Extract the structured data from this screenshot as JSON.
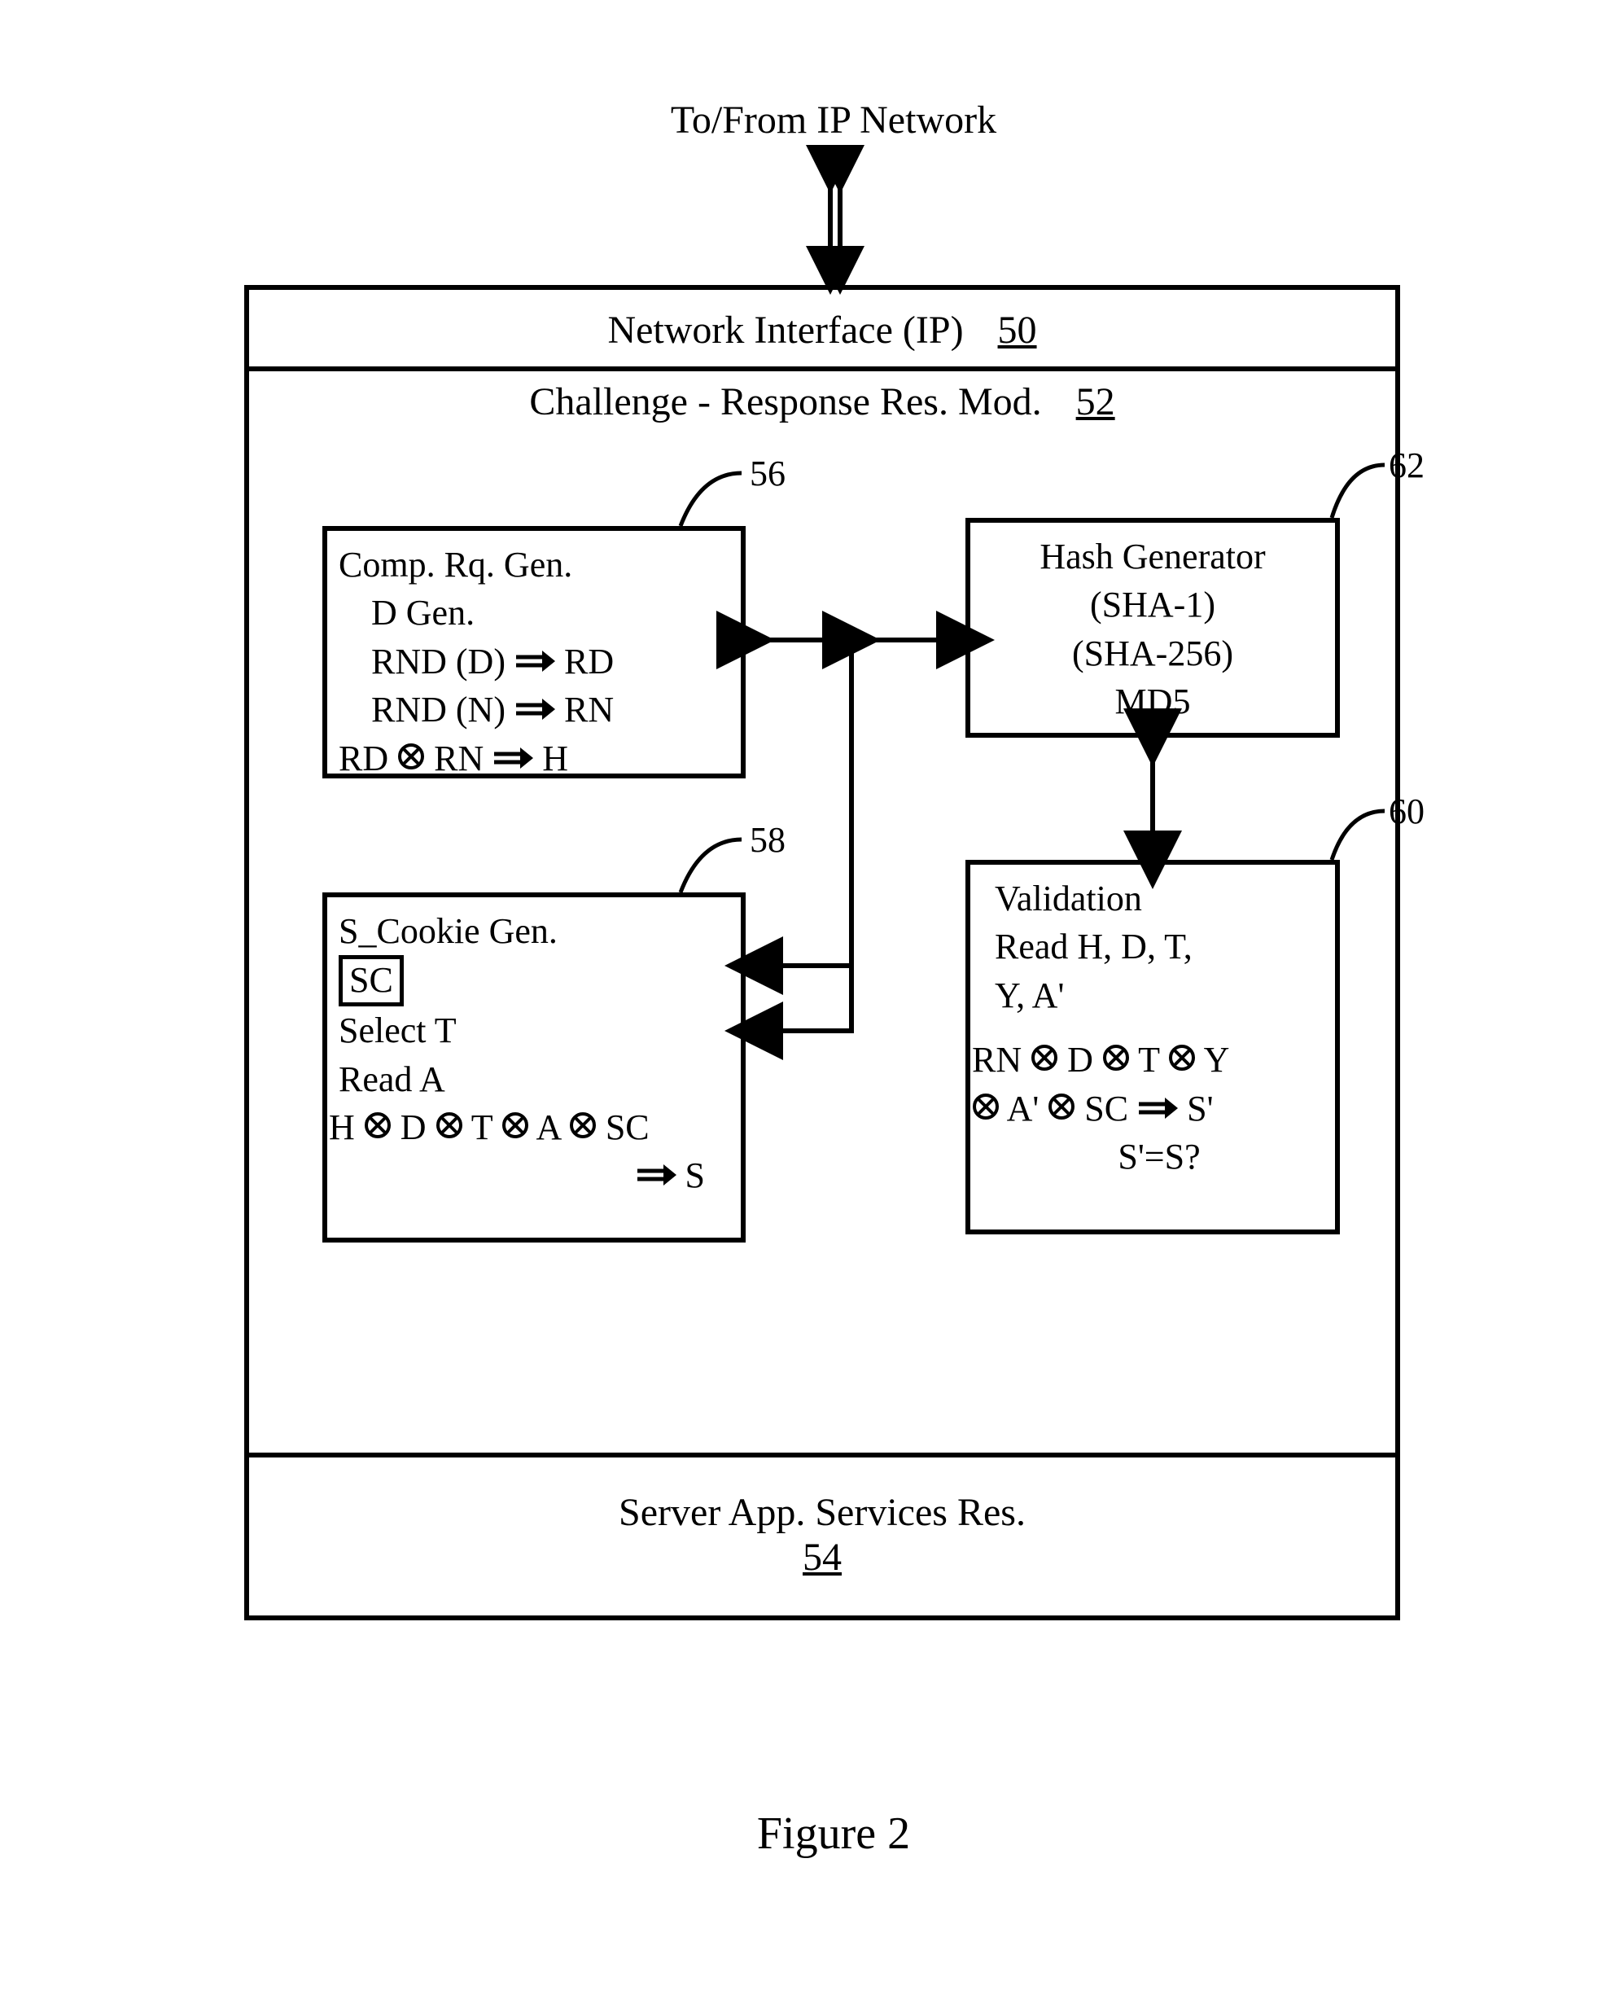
{
  "top_label": "To/From IP Network",
  "network_interface": {
    "label": "Network Interface (IP)",
    "ref": "50"
  },
  "challenge": {
    "label": "Challenge - Response Res. Mod.",
    "ref": "52"
  },
  "server_app": {
    "label": "Server App. Services Res.",
    "ref": "54"
  },
  "box56": {
    "ref": "56",
    "l1": "Comp. Rq. Gen.",
    "l2": "D Gen.",
    "l3a": "RND (D) ",
    "l3b": "RD",
    "l4a": "RND (N) ",
    "l4b": "RN",
    "l5a": "RD",
    "l5b": "RN",
    "l5c": "H"
  },
  "box62": {
    "ref": "62",
    "l1": "Hash Generator",
    "l2": "(SHA-1)",
    "l3": "(SHA-256)",
    "l4": "MD5"
  },
  "box58": {
    "ref": "58",
    "l1": "S_Cookie Gen.",
    "sc": "SC",
    "l3": "Select T",
    "l4": "Read A",
    "l5a": "H",
    "l5b": "D",
    "l5c": "T",
    "l5d": "A",
    "l5e": " SC",
    "l6": "S"
  },
  "box60": {
    "ref": "60",
    "l1": "Validation",
    "l2": "Read H, D, T,",
    "l3": "Y, A'",
    "l4a": "RN",
    "l4b": "D",
    "l4c": "T",
    "l4d": "Y",
    "l5a": "A'",
    "l5b": "SC ",
    "l5c": "S'",
    "l6": "S'=S?"
  },
  "figure_label": "Figure 2"
}
